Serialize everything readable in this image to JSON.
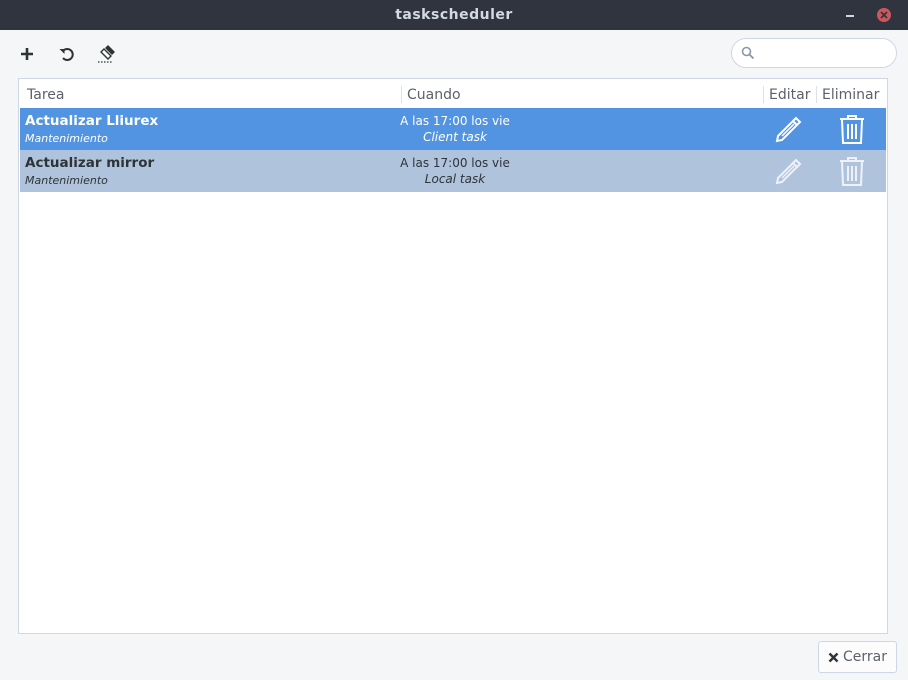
{
  "window": {
    "title": "taskscheduler"
  },
  "toolbar": {
    "add_icon": "plus-icon",
    "refresh_icon": "refresh-icon",
    "clean_icon": "eraser-icon"
  },
  "search": {
    "value": "",
    "placeholder": "",
    "icon": "search-icon"
  },
  "table": {
    "columns": [
      "Tarea",
      "Cuando",
      "Editar",
      "Eliminar"
    ],
    "rows": [
      {
        "name": "Actualizar Lliurex",
        "type": "Mantenimiento",
        "when": "A las 17:00 los vie",
        "origin": "Client task",
        "selected": true,
        "edit_icon": "pencil-icon",
        "delete_icon": "trash-icon"
      },
      {
        "name": "Actualizar mirror",
        "type": "Mantenimiento",
        "when": "A las 17:00 los vie",
        "origin": "Local task",
        "selected": false,
        "edit_icon": "pencil-icon",
        "delete_icon": "trash-icon"
      }
    ]
  },
  "footer": {
    "close_label": "Cerrar",
    "close_icon": "close-x-icon"
  },
  "colors": {
    "titlebar": "#2f343f",
    "selected_row": "#5294e2",
    "secondary_row": "#b0c3dd",
    "close_window": "#cc575d"
  }
}
